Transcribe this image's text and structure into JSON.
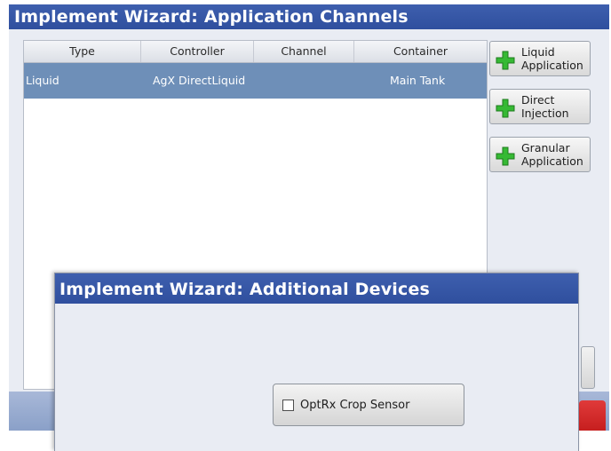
{
  "main_window": {
    "title": "Implement Wizard:  Application Channels"
  },
  "table": {
    "columns": [
      "Type",
      "Controller",
      "Channel",
      "Container"
    ],
    "rows": [
      {
        "type": "Liquid",
        "controller": "AgX DirectLiquid",
        "channel": "",
        "container": "Main Tank"
      }
    ]
  },
  "side_buttons": [
    {
      "line1": "Liquid",
      "line2": "Application",
      "icon": "green-plus-icon"
    },
    {
      "line1": "Direct",
      "line2": "Injection",
      "icon": "green-plus-icon"
    },
    {
      "line1": "Granular",
      "line2": "Application",
      "icon": "green-plus-icon"
    }
  ],
  "overlay": {
    "title": "Implement Wizard:  Additional Devices",
    "checkbox_label": "OptRx Crop Sensor",
    "checked": false
  },
  "colors": {
    "title_bar": "#2f4f9e",
    "selected_row": "#6e8fb8",
    "plus_icon": "#36b934",
    "cancel_red": "#c01818"
  }
}
